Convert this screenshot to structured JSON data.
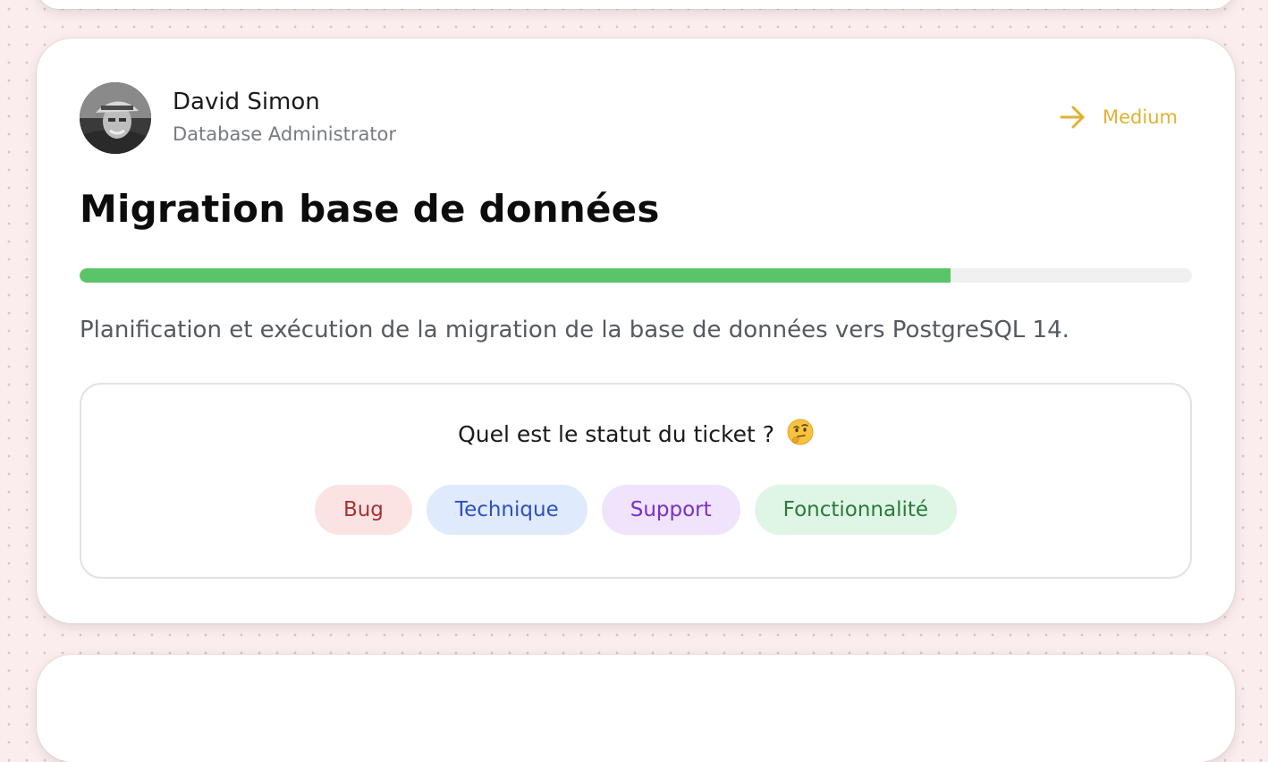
{
  "ticket": {
    "user": {
      "name": "David Simon",
      "role": "Database Administrator"
    },
    "priority": {
      "label": "Medium",
      "icon": "arrow-right-icon",
      "color": "#e0b232"
    },
    "title": "Migration base de données",
    "progress_percent": 78.3,
    "description": "Planification et exécution de la migration de la base de données vers PostgreSQL 14.",
    "status_question": "Quel est le statut du ticket ?",
    "status_emoji": "thinking-face-icon",
    "tags": [
      {
        "label": "Bug",
        "color": "#a83232",
        "background": "#fbe3e3"
      },
      {
        "label": "Technique",
        "color": "#2e4fc4",
        "background": "#dfeafc"
      },
      {
        "label": "Support",
        "color": "#7a2fc8",
        "background": "#efe4fb"
      },
      {
        "label": "Fonctionnalité",
        "color": "#2a7a38",
        "background": "#dff6e6"
      }
    ]
  },
  "colors": {
    "page_background": "#fbeced",
    "progress_fill": "#5ac568",
    "progress_track": "#f0f0f0"
  }
}
